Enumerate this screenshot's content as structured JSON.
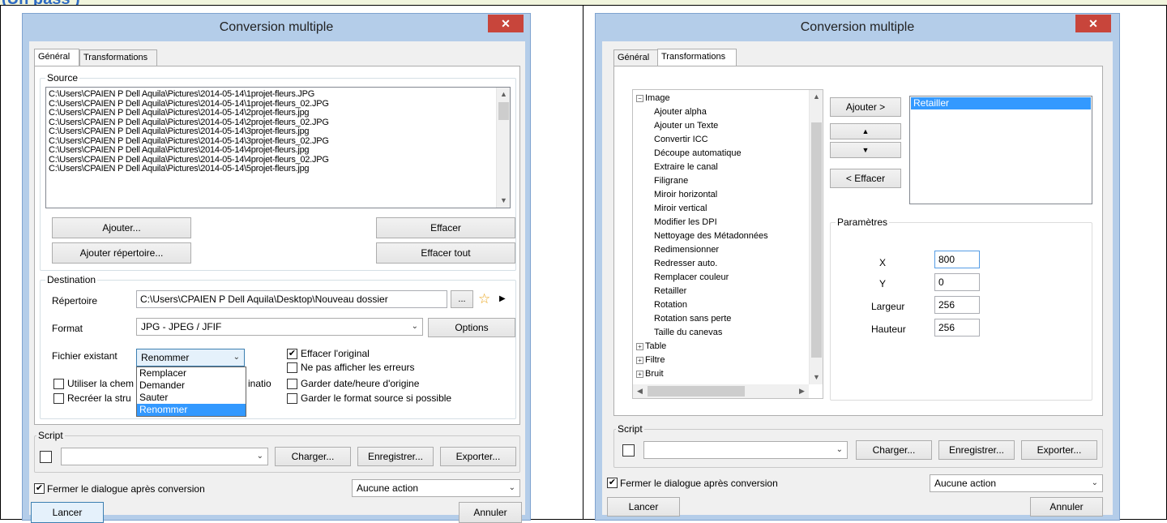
{
  "header_fragment": "(Un pass )",
  "left": {
    "title": "Conversion multiple",
    "close_glyph": "✕",
    "tabs": [
      "Général",
      "Transformations"
    ],
    "source_label": "Source",
    "source_files": [
      "C:\\Users\\CPAIEN P Dell Aquila\\Pictures\\2014-05-14\\1projet-fleurs.JPG",
      "C:\\Users\\CPAIEN P Dell Aquila\\Pictures\\2014-05-14\\1projet-fleurs_02.JPG",
      "C:\\Users\\CPAIEN P Dell Aquila\\Pictures\\2014-05-14\\2projet-fleurs.jpg",
      "C:\\Users\\CPAIEN P Dell Aquila\\Pictures\\2014-05-14\\2projet-fleurs_02.JPG",
      "C:\\Users\\CPAIEN P Dell Aquila\\Pictures\\2014-05-14\\3projet-fleurs.jpg",
      "C:\\Users\\CPAIEN P Dell Aquila\\Pictures\\2014-05-14\\3projet-fleurs_02.JPG",
      "C:\\Users\\CPAIEN P Dell Aquila\\Pictures\\2014-05-14\\4projet-fleurs.jpg",
      "C:\\Users\\CPAIEN P Dell Aquila\\Pictures\\2014-05-14\\4projet-fleurs_02.JPG",
      "C:\\Users\\CPAIEN P Dell Aquila\\Pictures\\2014-05-14\\5projet-fleurs.jpg"
    ],
    "btn_add": "Ajouter...",
    "btn_add_dir": "Ajouter répertoire...",
    "btn_clear": "Effacer",
    "btn_clear_all": "Effacer tout",
    "dest_label": "Destination",
    "dir_label": "Répertoire",
    "dir_value": "C:\\Users\\CPAIEN P Dell Aquila\\Desktop\\Nouveau dossier",
    "browse": "...",
    "format_label": "Format",
    "format_value": "JPG - JPEG / JFIF",
    "options": "Options",
    "existing_label": "Fichier existant",
    "existing_value": "Renommer",
    "existing_options": [
      "Remplacer",
      "Demander",
      "Sauter",
      "Renommer"
    ],
    "chk_delete_orig": "Effacer l'original",
    "chk_no_errors": "Ne pas afficher les erreurs",
    "chk_keep_date": "Garder date/heure d'origine",
    "chk_keep_format": "Garder le format source si possible",
    "chk_use_path": "Utiliser la chem",
    "chk_use_path_tail": "inatio",
    "chk_recreate": "Recréer la stru",
    "script_label": "Script",
    "load": "Charger...",
    "save": "Enregistrer...",
    "export": "Exporter...",
    "close_after": "Fermer le dialogue après conversion",
    "action_value": "Aucune action",
    "run": "Lancer",
    "cancel": "Annuler"
  },
  "right": {
    "title": "Conversion multiple",
    "close_glyph": "✕",
    "tabs": [
      "Général",
      "Transformations"
    ],
    "tree_root": "Image",
    "tree_items": [
      "Ajouter alpha",
      "Ajouter un Texte",
      "Convertir ICC",
      "Découpe automatique",
      "Extraire le canal",
      "Filigrane",
      "Miroir horizontal",
      "Miroir vertical",
      "Modifier les DPI",
      "Nettoyage des Métadonnées",
      "Redimensionner",
      "Redresser auto.",
      "Remplacer couleur",
      "Retailler",
      "Rotation",
      "Rotation sans perte",
      "Taille du canevas"
    ],
    "tree_other": [
      "Table",
      "Filtre",
      "Bruit"
    ],
    "add": "Ajouter >",
    "up": "▲",
    "down": "▼",
    "remove": "< Effacer",
    "selected_transform": "Retailler",
    "params_label": "Paramètres",
    "x_label": "X",
    "x_value": "800",
    "y_label": "Y",
    "y_value": "0",
    "w_label": "Largeur",
    "w_value": "256",
    "h_label": "Hauteur",
    "h_value": "256",
    "script_label": "Script",
    "load": "Charger...",
    "save": "Enregistrer...",
    "export": "Exporter...",
    "close_after": "Fermer le dialogue après conversion",
    "action_value": "Aucune action",
    "run": "Lancer",
    "cancel": "Annuler"
  }
}
